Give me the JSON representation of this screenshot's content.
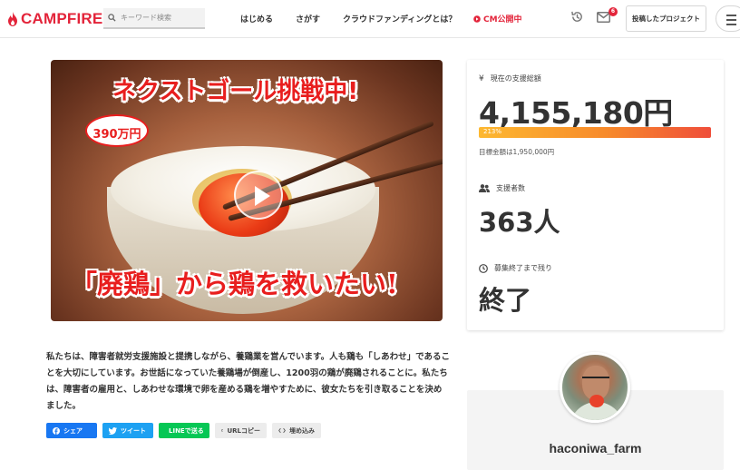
{
  "header": {
    "logo_text": "CAMPFIRE",
    "search_placeholder": "キーワード検索",
    "nav": [
      "はじめる",
      "さがす",
      "クラウドファンディングとは？",
      "CM公開中"
    ],
    "notification_count": "6",
    "post_button": "投稿したプロジェクト"
  },
  "hero": {
    "headline": "ネクストゴール挑戦中!",
    "next_goal_badge": "390万円",
    "subheadline": "「廃鶏」から鶏を救いたい!"
  },
  "description": "私たちは、障害者就労支援施設と提携しながら、養鶏業を営んでいます。人も鶏も「しあわせ」であることを大切にしています。お世話になっていた養鶏場が倒産し、1200羽の鶏が廃鶏されることに。私たちは、障害者の雇用と、しあわせな環境で卵を産める鶏を増やすために、彼女たちを引き取ることを決めました。",
  "share": {
    "facebook": "シェア",
    "twitter": "ツイート",
    "line": "LINEで送る",
    "url_copy": "URLコピー",
    "embed": "埋め込み"
  },
  "stats": {
    "funded_label": "現在の支援総額",
    "funded_amount": "4,155,180円",
    "progress_text": "213%",
    "progress_percent": 213,
    "goal_text": "目標金額は1,950,000円",
    "backers_label": "支援者数",
    "backers_count": "363人",
    "remaining_label": "募集終了まで残り",
    "remaining_value": "終了"
  },
  "owner": {
    "name": "haconiwa_farm"
  },
  "colors": {
    "brand_red": "#e3243a",
    "progress_start": "#fdb830",
    "progress_end": "#ef4e3a"
  }
}
